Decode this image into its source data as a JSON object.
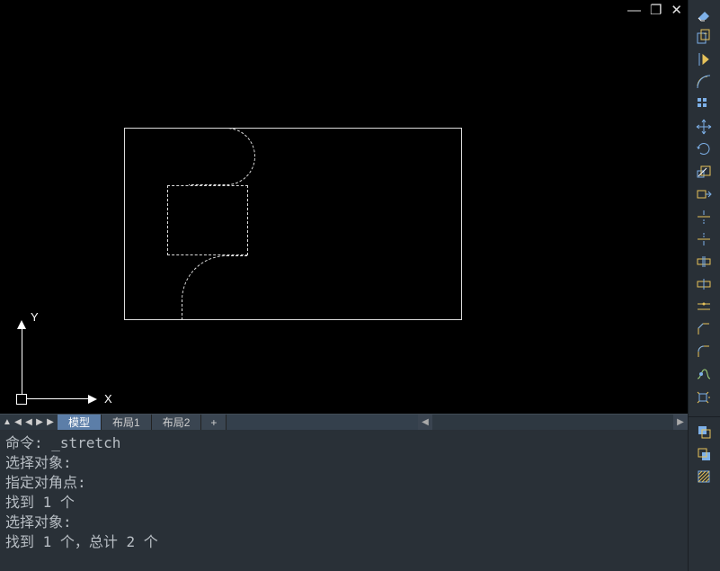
{
  "window_controls": {
    "min": "—",
    "restore": "❐",
    "close": "✕"
  },
  "ucs": {
    "x": "X",
    "y": "Y"
  },
  "tabs": {
    "active": "模型",
    "items": [
      "模型",
      "布局1",
      "布局2"
    ],
    "plus": "+"
  },
  "nav": {
    "first": "▲",
    "prev": "◀",
    "prev2": "◀",
    "next": "▶",
    "next2": "▶"
  },
  "scroll": {
    "left": "◀",
    "right": "▶",
    "up": "▲",
    "down": "▼"
  },
  "command_lines": [
    "命令: _stretch",
    "选择对象:",
    "指定对角点:",
    "找到 1 个",
    "选择对象:",
    "找到 1 个，总计 2 个"
  ],
  "tools_modify": [
    "erase",
    "copy",
    "mirror",
    "offset",
    "array",
    "move",
    "rotate",
    "scale",
    "stretch",
    "trim",
    "extend",
    "break",
    "break2",
    "join",
    "chamfer",
    "fillet",
    "blend",
    "explode"
  ],
  "tools_draworder": [
    "front",
    "back",
    "hatch-back"
  ]
}
